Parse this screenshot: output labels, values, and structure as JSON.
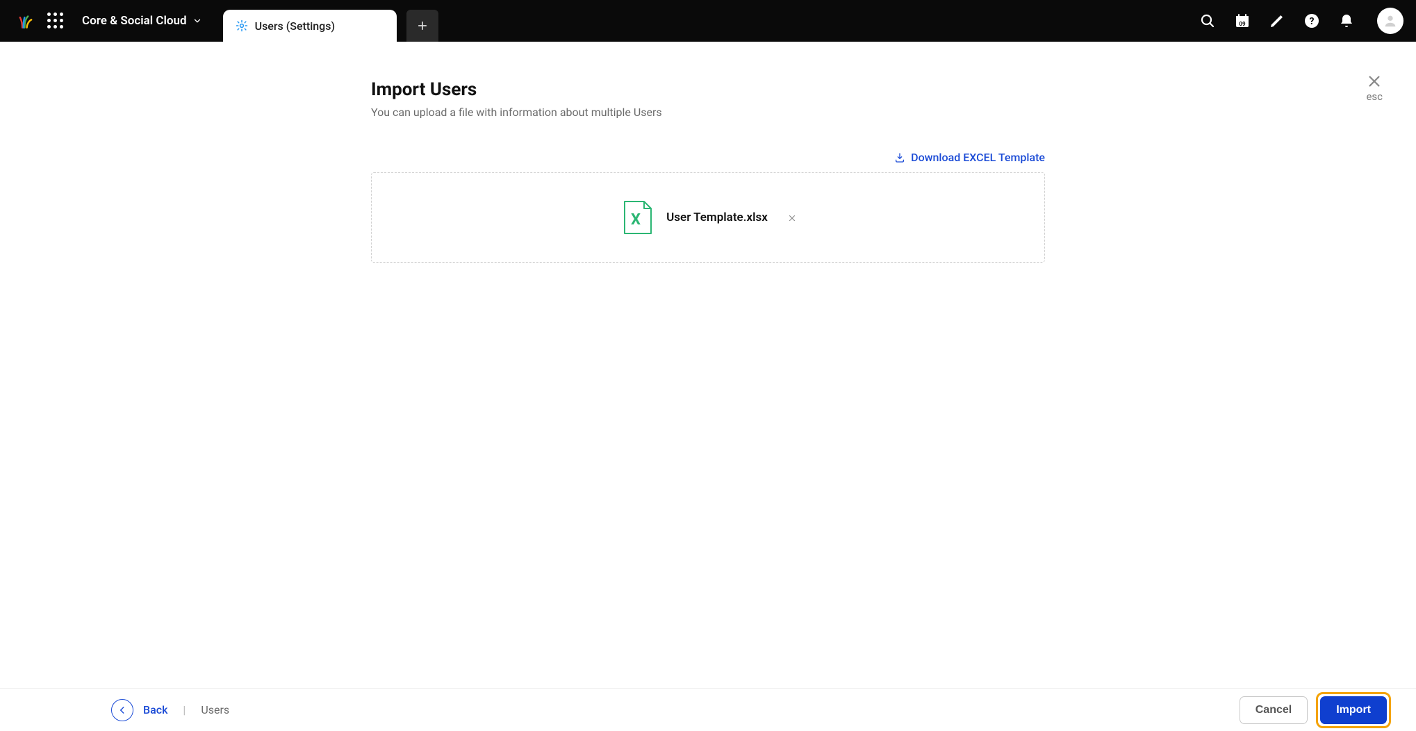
{
  "header": {
    "workspace_label": "Core & Social Cloud",
    "tabs": [
      {
        "label": "Users (Settings)"
      }
    ],
    "calendar_day": "09"
  },
  "page": {
    "title": "Import Users",
    "subtitle": "You can upload a file with information about multiple Users",
    "download_template_label": "Download EXCEL Template",
    "uploaded_file": {
      "name": "User Template.xlsx",
      "icon_letter": "X"
    },
    "close_hint": "esc"
  },
  "footer": {
    "back_label": "Back",
    "breadcrumb_current": "Users",
    "cancel_label": "Cancel",
    "import_label": "Import"
  }
}
